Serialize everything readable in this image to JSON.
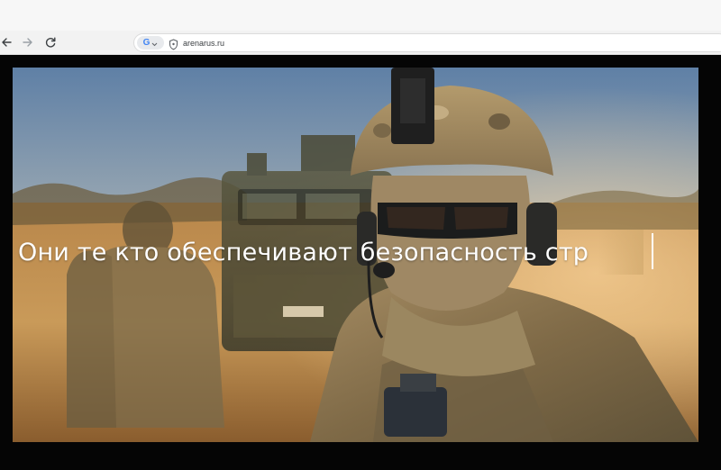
{
  "browser": {
    "address_bar": {
      "url": "arenarus.ru",
      "search_engine_icon": "google-g-icon",
      "security_icon": "shield-icon"
    },
    "nav": {
      "back_icon": "arrow-left-icon",
      "forward_icon": "arrow-right-icon",
      "reload_icon": "reload-icon"
    }
  },
  "video": {
    "caption": "Они те кто обеспечивают безопасность стр"
  },
  "colors": {
    "toolbar_bg": "#f2f2f2",
    "frame_bg": "#050505",
    "caption_color": "#ffffff"
  }
}
